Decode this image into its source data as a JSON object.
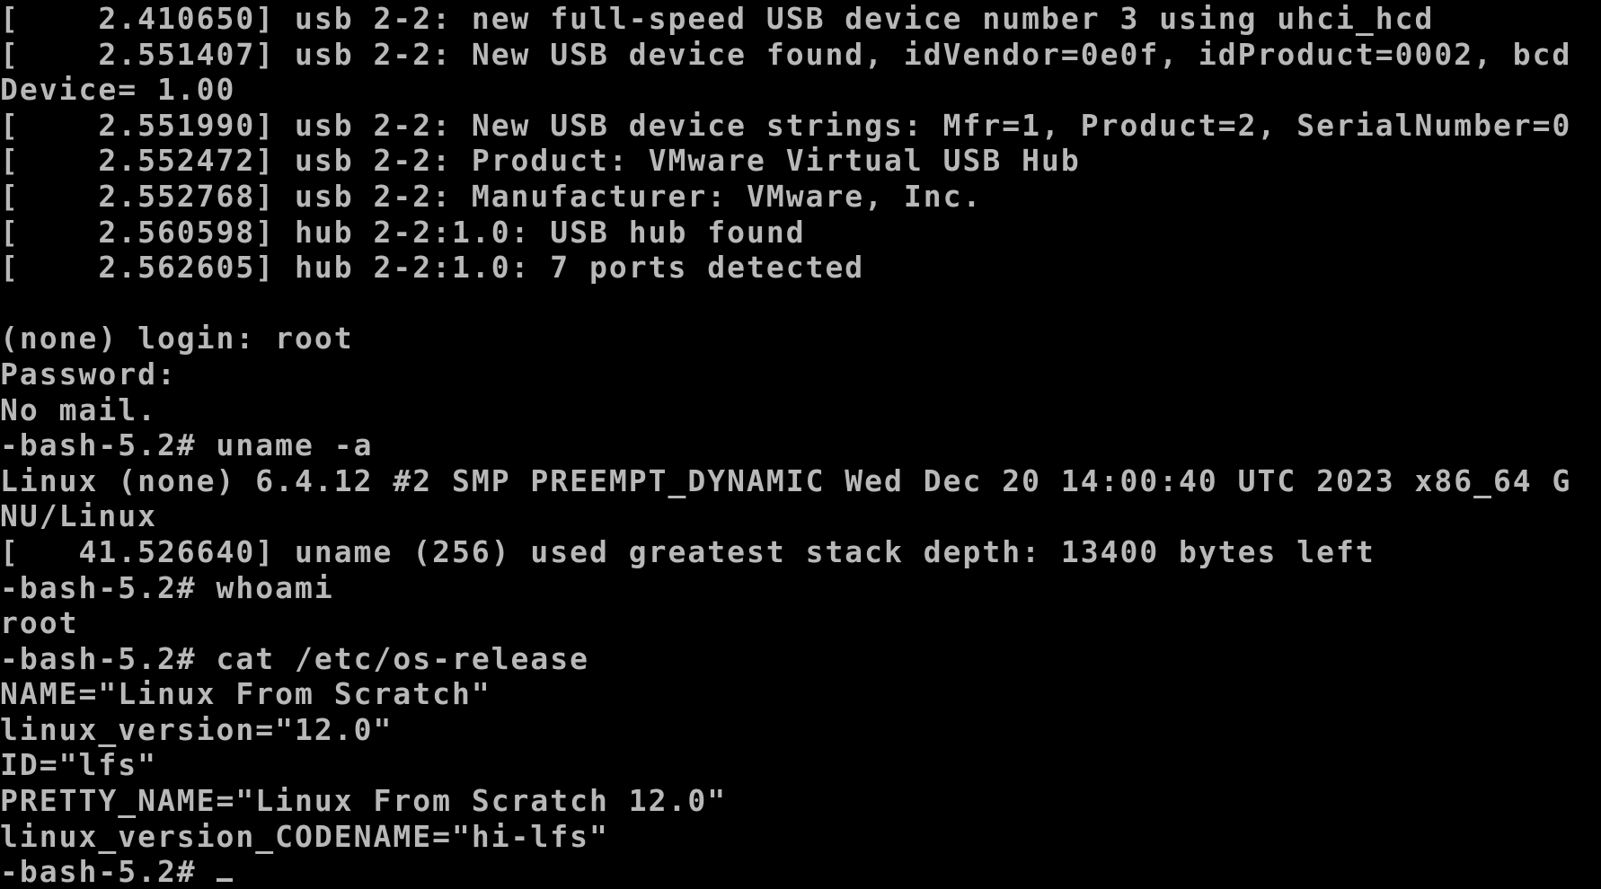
{
  "terminal": {
    "text_color": "#b8b8b8",
    "background_color": "#000000",
    "lines": [
      "[    2.410650] usb 2-2: new full-speed USB device number 3 using uhci_hcd",
      "[    2.551407] usb 2-2: New USB device found, idVendor=0e0f, idProduct=0002, bcd",
      "Device= 1.00",
      "[    2.551990] usb 2-2: New USB device strings: Mfr=1, Product=2, SerialNumber=0",
      "[    2.552472] usb 2-2: Product: VMware Virtual USB Hub",
      "[    2.552768] usb 2-2: Manufacturer: VMware, Inc.",
      "[    2.560598] hub 2-2:1.0: USB hub found",
      "[    2.562605] hub 2-2:1.0: 7 ports detected",
      "",
      "(none) login: root",
      "Password:",
      "No mail.",
      "-bash-5.2# uname -a",
      "Linux (none) 6.4.12 #2 SMP PREEMPT_DYNAMIC Wed Dec 20 14:00:40 UTC 2023 x86_64 G",
      "NU/Linux",
      "[   41.526640] uname (256) used greatest stack depth: 13400 bytes left",
      "-bash-5.2# whoami",
      "root",
      "-bash-5.2# cat /etc/os-release",
      "NAME=\"Linux From Scratch\"",
      "linux_version=\"12.0\"",
      "ID=\"lfs\"",
      "PRETTY_NAME=\"Linux From Scratch 12.0\"",
      "linux_version_CODENAME=\"hi-lfs\""
    ],
    "prompt": "-bash-5.2# "
  }
}
